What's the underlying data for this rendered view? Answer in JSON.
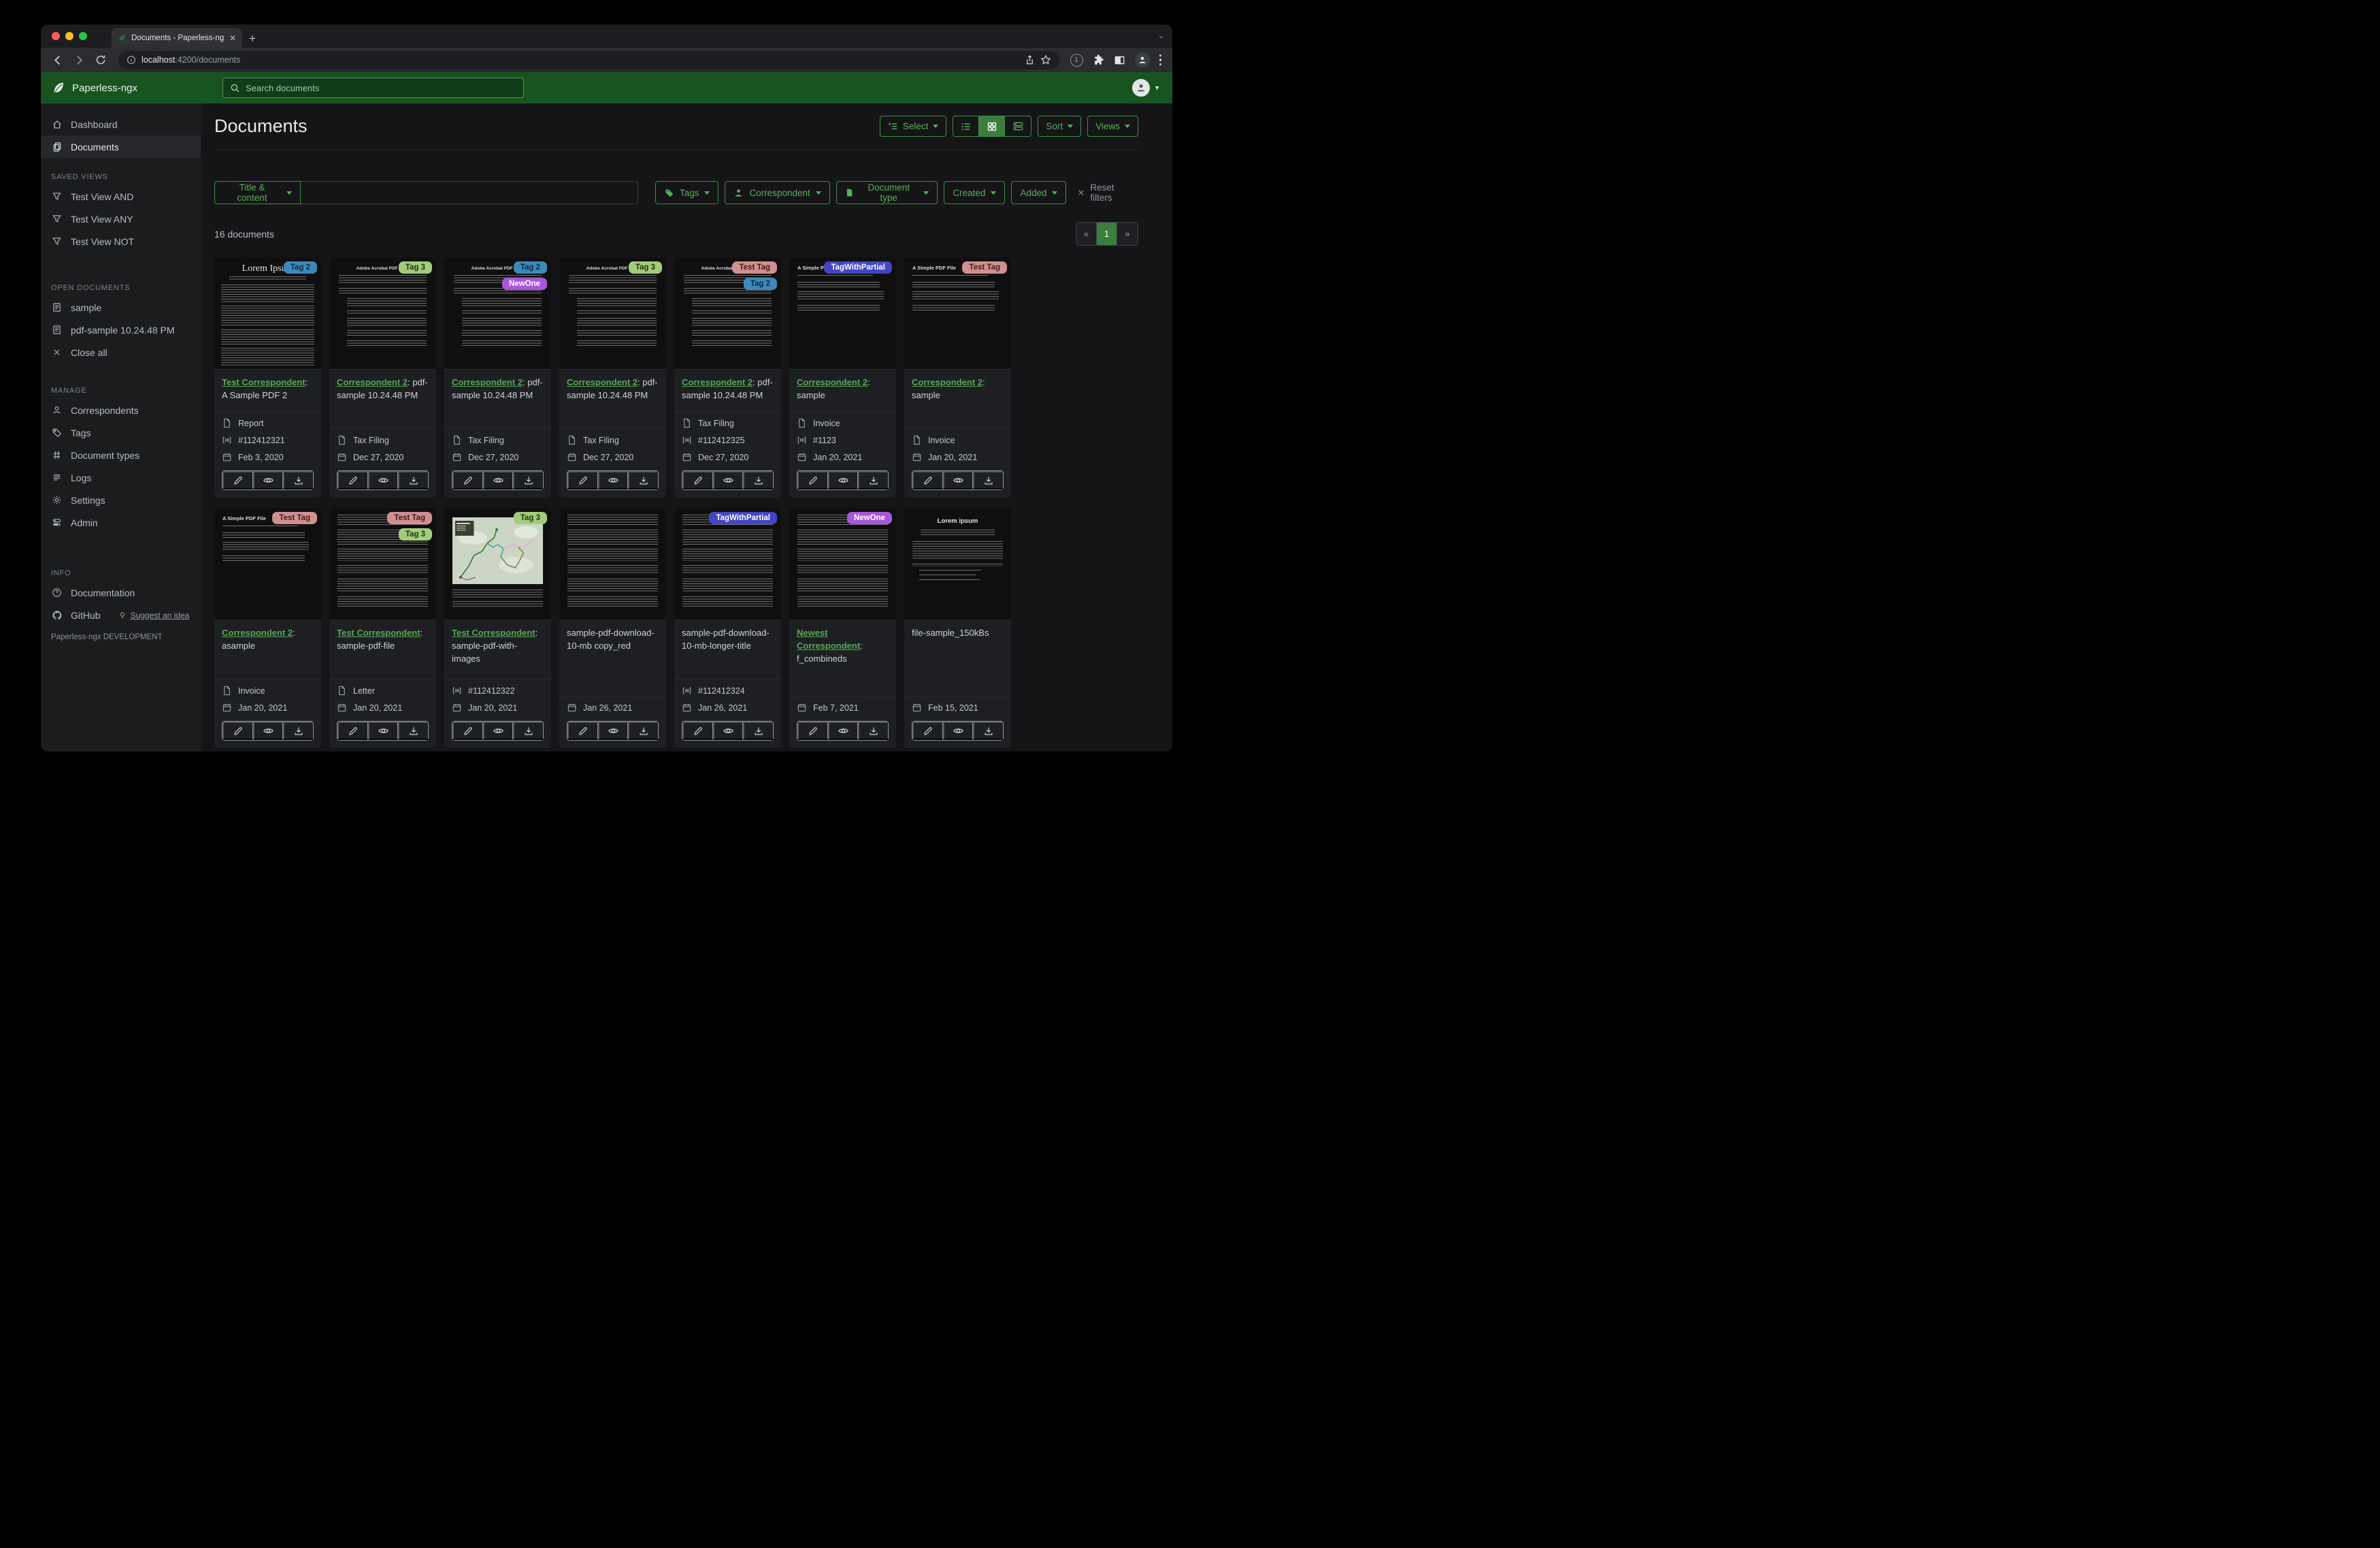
{
  "browser": {
    "tab_title": "Documents - Paperless-ngx",
    "url_host": "localhost",
    "url_rest": ":4200/documents",
    "extension_badge": "1",
    "new_tab": "+"
  },
  "appbar": {
    "brand": "Paperless-ngx",
    "search_placeholder": "Search documents"
  },
  "sidebar": {
    "dashboard": "Dashboard",
    "documents": "Documents",
    "saved_views_header": "SAVED VIEWS",
    "saved_views": [
      "Test View AND",
      "Test View ANY",
      "Test View NOT"
    ],
    "open_documents_header": "OPEN DOCUMENTS",
    "open_documents": [
      "sample",
      "pdf-sample 10.24.48 PM"
    ],
    "close_all": "Close all",
    "manage_header": "MANAGE",
    "manage": [
      "Correspondents",
      "Tags",
      "Document types",
      "Logs",
      "Settings",
      "Admin"
    ],
    "info_header": "INFO",
    "documentation": "Documentation",
    "github": "GitHub",
    "suggest": "Suggest an idea",
    "footer": "Paperless-ngx DEVELOPMENT"
  },
  "controls": {
    "select": "Select",
    "sort": "Sort",
    "views": "Views"
  },
  "filters": {
    "field": "Title & content",
    "input_value": "",
    "tags": "Tags",
    "correspondent": "Correspondent",
    "document_type": "Document type",
    "created": "Created",
    "added": "Added",
    "reset": "Reset filters"
  },
  "results": {
    "count": "16 documents",
    "page_prev": "«",
    "page_current": "1",
    "page_next": "»"
  },
  "accent_colors": {
    "header_green": "#175420",
    "button_green": "#58b058",
    "active_green": "#3a7d3d",
    "link_green": "#58a758"
  },
  "cards": [
    {
      "thumb": "lorem-serif",
      "heading": "Lorem Ipsum",
      "tags": [
        {
          "label": "Tag 2",
          "bg": "#3d89bd",
          "fg": "#0b2a42"
        }
      ],
      "correspondent": "Test Correspondent",
      "title": "A Sample PDF 2",
      "type": "Report",
      "asn": "#112412321",
      "date": "Feb 3, 2020"
    },
    {
      "thumb": "acrobat",
      "heading": "Adobe Acrobat PDF Files",
      "tags": [
        {
          "label": "Tag 3",
          "bg": "#a2cd7c",
          "fg": "#23320f"
        }
      ],
      "correspondent": "Correspondent 2",
      "title": "pdf-sample 10.24.48 PM",
      "type": "Tax Filing",
      "asn": "",
      "date": "Dec 27, 2020"
    },
    {
      "thumb": "acrobat",
      "heading": "Adobe Acrobat PDF Files",
      "tags": [
        {
          "label": "Tag 2",
          "bg": "#3d89bd",
          "fg": "#0b2a42"
        },
        {
          "label": "NewOne",
          "bg": "#a757d8",
          "fg": "#ffffff"
        }
      ],
      "correspondent": "Correspondent 2",
      "title": "pdf-sample 10.24.48 PM",
      "type": "Tax Filing",
      "asn": "",
      "date": "Dec 27, 2020"
    },
    {
      "thumb": "acrobat",
      "heading": "Adobe Acrobat PDF Files",
      "tags": [
        {
          "label": "Tag 3",
          "bg": "#a2cd7c",
          "fg": "#23320f"
        }
      ],
      "correspondent": "Correspondent 2",
      "title": "pdf-sample 10.24.48 PM",
      "type": "Tax Filing",
      "asn": "",
      "date": "Dec 27, 2020"
    },
    {
      "thumb": "acrobat",
      "heading": "Adobe Acrobat PDF Files",
      "tags": [
        {
          "label": "Test Tag",
          "bg": "#d09090",
          "fg": "#401b1b"
        },
        {
          "label": "Tag 2",
          "bg": "#3d89bd",
          "fg": "#0b2a42"
        }
      ],
      "correspondent": "Correspondent 2",
      "title": "pdf-sample 10.24.48 PM",
      "type": "Tax Filing",
      "asn": "#112412325",
      "date": "Dec 27, 2020"
    },
    {
      "thumb": "simple",
      "heading": "A Simple PDF File",
      "tags": [
        {
          "label": "TagWithPartial",
          "bg": "#4246c4",
          "fg": "#ffffff"
        }
      ],
      "correspondent": "Correspondent 2",
      "title": "sample",
      "type": "Invoice",
      "asn": "#1123",
      "date": "Jan 20, 2021"
    },
    {
      "thumb": "simple",
      "heading": "A Simple PDF File",
      "tags": [
        {
          "label": "Test Tag",
          "bg": "#d09090",
          "fg": "#401b1b"
        }
      ],
      "correspondent": "Correspondent 2",
      "title": "sample",
      "type": "Invoice",
      "asn": "",
      "date": "Jan 20, 2021"
    },
    {
      "thumb": "simple",
      "heading": "A Simple PDF File",
      "tags": [
        {
          "label": "Test Tag",
          "bg": "#d09090",
          "fg": "#401b1b"
        }
      ],
      "correspondent": "Correspondent 2",
      "title": "asample",
      "type": "Invoice",
      "asn": "",
      "date": "Jan 20, 2021"
    },
    {
      "thumb": "text",
      "heading": "",
      "tags": [
        {
          "label": "Test Tag",
          "bg": "#d09090",
          "fg": "#401b1b"
        },
        {
          "label": "Tag 3",
          "bg": "#a2cd7c",
          "fg": "#23320f"
        }
      ],
      "correspondent": "Test Correspondent",
      "title": "sample-pdf-file",
      "type": "Letter",
      "asn": "",
      "date": "Jan 20, 2021"
    },
    {
      "thumb": "map",
      "heading": "",
      "tags": [
        {
          "label": "Tag 3",
          "bg": "#a2cd7c",
          "fg": "#23320f"
        }
      ],
      "correspondent": "Test Correspondent",
      "title": "sample-pdf-with-images",
      "type": "",
      "asn": "#112412322",
      "date": "Jan 20, 2021"
    },
    {
      "thumb": "text",
      "heading": "",
      "tags": [],
      "correspondent": "",
      "title": "sample-pdf-download-10-mb copy_red",
      "type": "",
      "asn": "",
      "date": "Jan 26, 2021"
    },
    {
      "thumb": "text",
      "heading": "",
      "tags": [
        {
          "label": "TagWithPartial",
          "bg": "#4246c4",
          "fg": "#ffffff"
        }
      ],
      "correspondent": "",
      "title": "sample-pdf-download-10-mb-longer-title",
      "type": "",
      "asn": "#112412324",
      "date": "Jan 26, 2021"
    },
    {
      "thumb": "text",
      "heading": "",
      "tags": [
        {
          "label": "NewOne",
          "bg": "#a757d8",
          "fg": "#ffffff"
        }
      ],
      "correspondent": "Newest Correspondent",
      "title": "f_combineds",
      "type": "",
      "asn": "",
      "date": "Feb 7, 2021"
    },
    {
      "thumb": "lorem-sans",
      "heading": "Lorem ipsum",
      "tags": [],
      "correspondent": "",
      "title": "file-sample_150kBs",
      "type": "",
      "asn": "",
      "date": "Feb 15, 2021"
    }
  ]
}
